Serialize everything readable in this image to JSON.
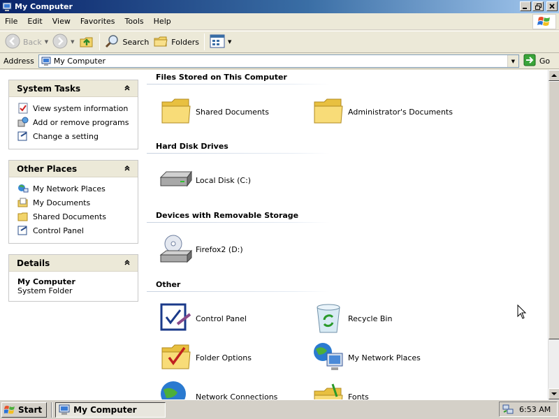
{
  "window": {
    "title": "My Computer",
    "controls": [
      "minimize",
      "maximize",
      "close"
    ]
  },
  "menubar": {
    "items": [
      "File",
      "Edit",
      "View",
      "Favorites",
      "Tools",
      "Help"
    ]
  },
  "toolbar": {
    "back_label": "Back",
    "search_label": "Search",
    "folders_label": "Folders"
  },
  "addressbar": {
    "label": "Address",
    "value": "My Computer",
    "go_label": "Go"
  },
  "sidebar": {
    "system_tasks": {
      "title": "System Tasks",
      "items": [
        {
          "label": "View system information",
          "icon": "system-info-icon"
        },
        {
          "label": "Add or remove programs",
          "icon": "add-remove-icon"
        },
        {
          "label": "Change a setting",
          "icon": "control-panel-icon"
        }
      ]
    },
    "other_places": {
      "title": "Other Places",
      "items": [
        {
          "label": "My Network Places",
          "icon": "network-places-icon"
        },
        {
          "label": "My Documents",
          "icon": "my-documents-icon"
        },
        {
          "label": "Shared Documents",
          "icon": "folder-icon"
        },
        {
          "label": "Control Panel",
          "icon": "control-panel-icon"
        }
      ]
    },
    "details": {
      "title": "Details",
      "name": "My Computer",
      "subtitle": "System Folder"
    }
  },
  "main": {
    "groups": [
      {
        "title": "Files Stored on This Computer",
        "items": [
          {
            "label": "Shared Documents",
            "icon": "folder-icon"
          },
          {
            "label": "Administrator's Documents",
            "icon": "folder-icon"
          }
        ]
      },
      {
        "title": "Hard Disk Drives",
        "items": [
          {
            "label": "Local Disk (C:)",
            "icon": "hard-disk-icon"
          }
        ]
      },
      {
        "title": "Devices with Removable Storage",
        "items": [
          {
            "label": "Firefox2 (D:)",
            "icon": "cd-drive-icon"
          }
        ]
      },
      {
        "title": "Other",
        "items": [
          {
            "label": "Control Panel",
            "icon": "control-panel-icon"
          },
          {
            "label": "Recycle Bin",
            "icon": "recycle-bin-icon"
          },
          {
            "label": "Folder Options",
            "icon": "folder-options-icon"
          },
          {
            "label": "My Network Places",
            "icon": "network-places-icon"
          },
          {
            "label": "Network Connections",
            "icon": "network-connections-icon"
          },
          {
            "label": "Fonts",
            "icon": "fonts-folder-icon"
          }
        ]
      }
    ]
  },
  "taskbar": {
    "start_label": "Start",
    "task_label": "My Computer",
    "clock": "6:53 AM"
  },
  "colors": {
    "title_bar_start": "#0a246a",
    "title_bar_end": "#a6caf0",
    "chrome": "#ece9d8",
    "taskbar": "#d4d0c8"
  }
}
